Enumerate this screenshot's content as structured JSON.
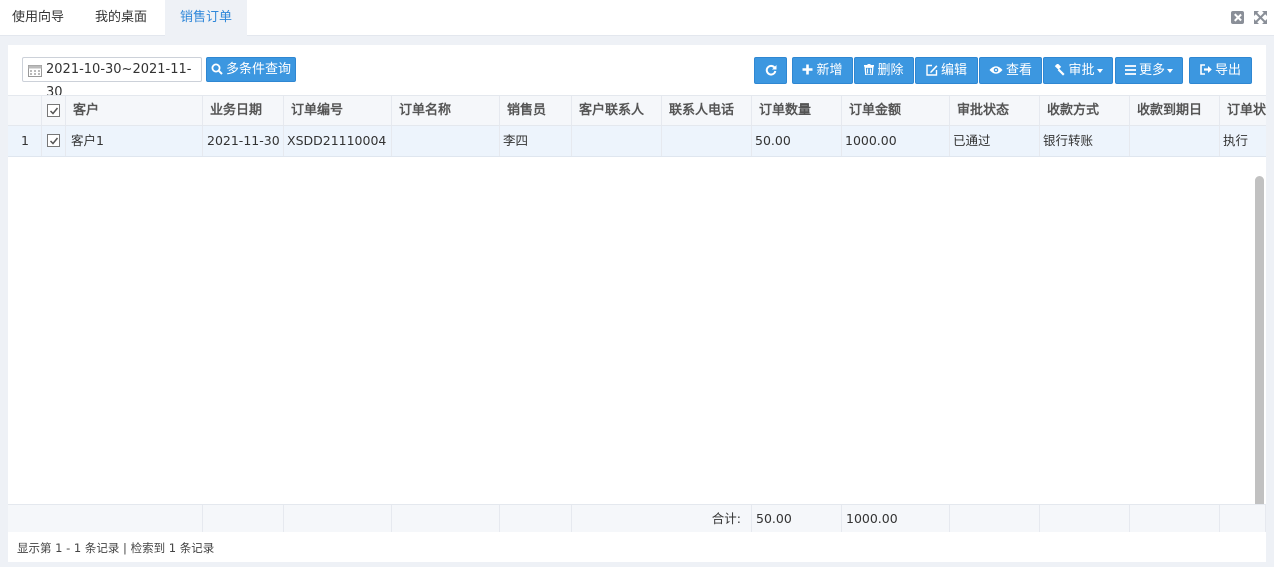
{
  "tabs": [
    {
      "label": "使用向导"
    },
    {
      "label": "我的桌面"
    },
    {
      "label": "销售订单"
    }
  ],
  "active_tab": "销售订单",
  "toolbar": {
    "date_range": "2021-10-30~2021-11-30",
    "query_label": "多条件查询",
    "add_label": "新增",
    "delete_label": "删除",
    "edit_label": "编辑",
    "view_label": "查看",
    "approve_label": "审批",
    "more_label": "更多",
    "export_label": "导出"
  },
  "columns": [
    "客户",
    "业务日期",
    "订单编号",
    "订单名称",
    "销售员",
    "客户联系人",
    "联系人电话",
    "订单数量",
    "订单金额",
    "审批状态",
    "收款方式",
    "收款到期日",
    "订单状态"
  ],
  "rows": [
    {
      "index": "1",
      "checked": true,
      "cells": [
        "客户1",
        "2021-11-30",
        "XSDD21110004",
        "",
        "李四",
        "",
        "",
        "50.00",
        "1000.00",
        "已通过",
        "银行转账",
        "",
        "执行"
      ]
    }
  ],
  "totals": {
    "label": "合计:",
    "quantity": "50.00",
    "amount": "1000.00"
  },
  "status_text": "显示第 1 - 1 条记录 | 检索到 1 条记录",
  "colors": {
    "accent": "#3c97e0",
    "active_tab_text": "#2f87d9"
  }
}
